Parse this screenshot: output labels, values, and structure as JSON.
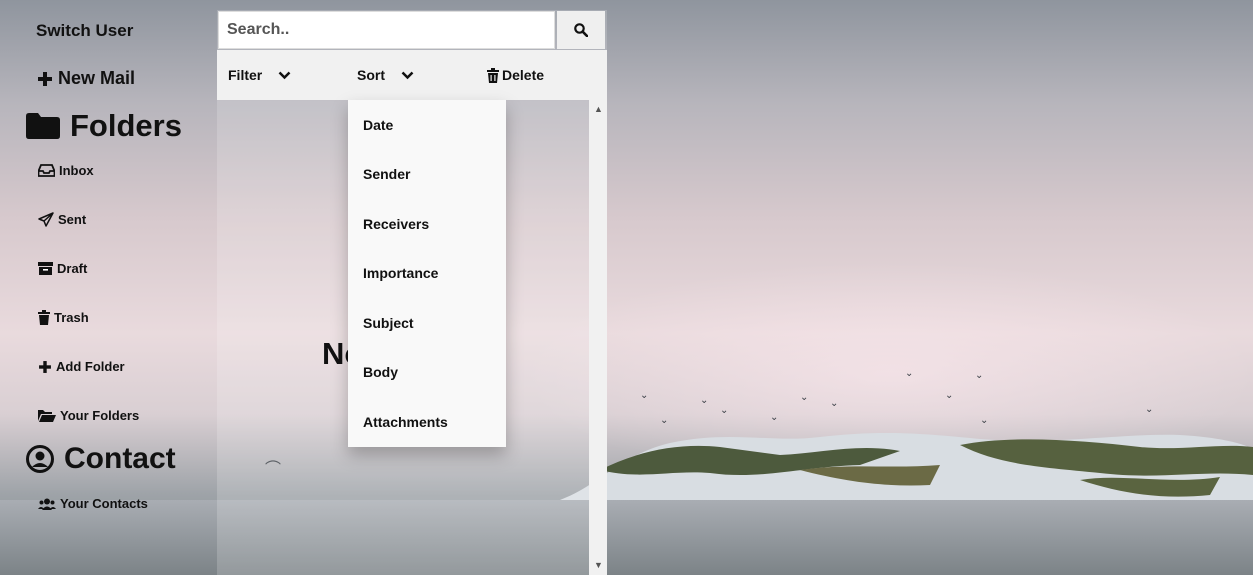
{
  "nav": {
    "switch_user": "Switch User",
    "new_mail": "New Mail",
    "folders_heading": "Folders",
    "items": [
      {
        "label": "Inbox"
      },
      {
        "label": "Sent"
      },
      {
        "label": "Draft"
      },
      {
        "label": "Trash"
      },
      {
        "label": "Add Folder"
      },
      {
        "label": "Your Folders"
      }
    ],
    "contact_heading": "Contact",
    "your_contacts": "Your Contacts"
  },
  "search": {
    "placeholder": "Search.."
  },
  "toolbar": {
    "filter": "Filter",
    "sort": "Sort",
    "delete": "Delete"
  },
  "sort_menu": {
    "options": [
      "Date",
      "Sender",
      "Receivers",
      "Importance",
      "Subject",
      "Body",
      "Attachments"
    ]
  },
  "main": {
    "empty_text": "No"
  },
  "icons": {
    "search": "search-icon",
    "chevron": "chevron-down-icon",
    "trash": "trash-icon",
    "folder": "folder-icon",
    "inbox": "inbox-icon",
    "sent": "paper-plane-icon",
    "draft": "archive-icon",
    "user": "user-circle-icon",
    "users": "users-icon"
  }
}
